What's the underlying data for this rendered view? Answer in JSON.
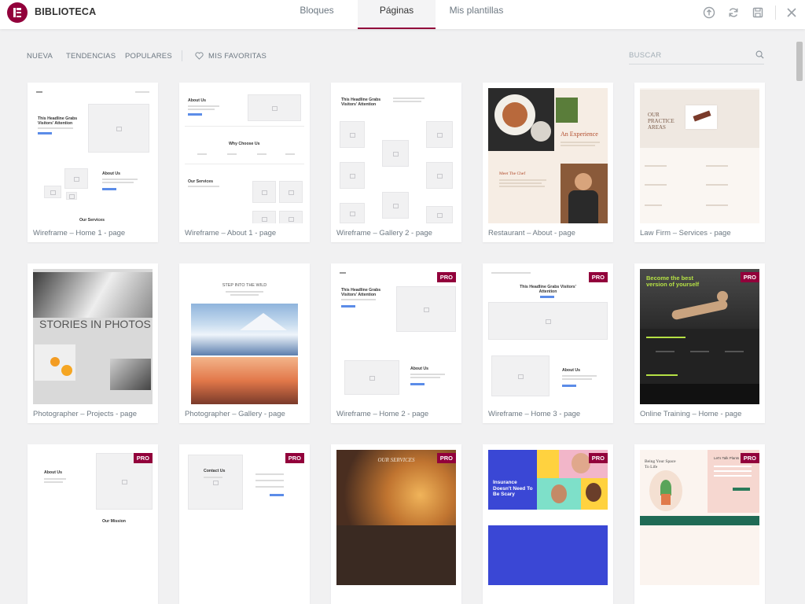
{
  "header": {
    "brand": "BIBLIOTECA",
    "tabs": [
      {
        "label": "Bloques"
      },
      {
        "label": "Páginas"
      },
      {
        "label": "Mis plantillas"
      }
    ],
    "icons": [
      "upload-icon",
      "sync-icon",
      "save-icon",
      "close-icon"
    ]
  },
  "filters": {
    "items": [
      "NUEVA",
      "TENDENCIAS",
      "POPULARES"
    ],
    "favorites": "MIS FAVORITAS",
    "search_placeholder": "BUSCAR"
  },
  "badge": "PRO",
  "cards": [
    {
      "title": "Wireframe – Home 1 - page"
    },
    {
      "title": "Wireframe – About 1 - page"
    },
    {
      "title": "Wireframe – Gallery 2 - page"
    },
    {
      "title": "Restaurant – About - page"
    },
    {
      "title": "Law Firm – Services - page"
    },
    {
      "title": "Photographer – Projects - page"
    },
    {
      "title": "Photographer – Gallery - page"
    },
    {
      "title": "Wireframe – Home 2 - page"
    },
    {
      "title": "Wireframe – Home 3 - page"
    },
    {
      "title": "Online Training – Home - page"
    },
    {
      "title": ""
    },
    {
      "title": ""
    },
    {
      "title": ""
    },
    {
      "title": ""
    },
    {
      "title": ""
    }
  ],
  "thumbs": {
    "headline": "This Headline Grabs Visitors' Attention",
    "about_us": "About Us",
    "our_services": "Our Services",
    "why_choose_us": "Why Choose Us",
    "an_experience": "An Experience",
    "meet_the_chef": "Meet The Chef",
    "our_practice_areas": "OUR PRACTICE AREAS",
    "stories_in_photos": "STORIES IN PHOTOS",
    "step_into_the_wild": "STEP INTO THE WILD",
    "become_the_best": "Become the best version of yourself",
    "our_mission": "Our Mission",
    "contact_us": "Contact Us",
    "our_services_serif": "OUR SERVICES",
    "insurance": "Insurance Doesn't Need To Be Scary",
    "being_your_space": "Being Your Space To Life",
    "lets_talk": "Let's Talk Plants"
  },
  "colors": {
    "accent": "#92003b",
    "button_blue": "#5b8ce8"
  }
}
